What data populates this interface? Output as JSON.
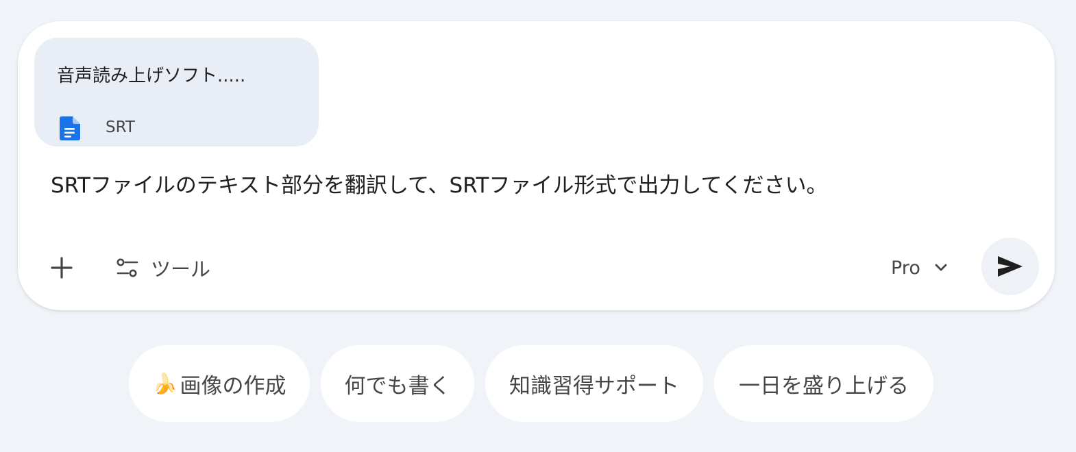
{
  "attachment": {
    "name": "音声読み上げソフト.....",
    "type_label": "SRT",
    "icon": "document-icon"
  },
  "prompt": {
    "text": "SRTファイルのテキスト部分を翻訳して、SRTファイル形式で出力してください。"
  },
  "toolbar": {
    "add_icon": "plus-icon",
    "tools_icon": "tune-icon",
    "tools_label": "ツール",
    "model_label": "Pro",
    "model_dropdown_icon": "chevron-down-icon",
    "send_icon": "send-icon"
  },
  "suggestions": [
    {
      "emoji": "🍌",
      "label": "画像の作成"
    },
    {
      "label": "何でも書く"
    },
    {
      "label": "知識習得サポート"
    },
    {
      "label": "一日を盛り上げる"
    }
  ],
  "colors": {
    "page_background": "#f0f4f8",
    "composer_background": "#ffffff",
    "attachment_background": "#e9eef6",
    "doc_icon_blue": "#1a73e8",
    "send_button_background": "#eef1f6",
    "text_primary": "#1f1f1f",
    "text_secondary": "#444746"
  }
}
